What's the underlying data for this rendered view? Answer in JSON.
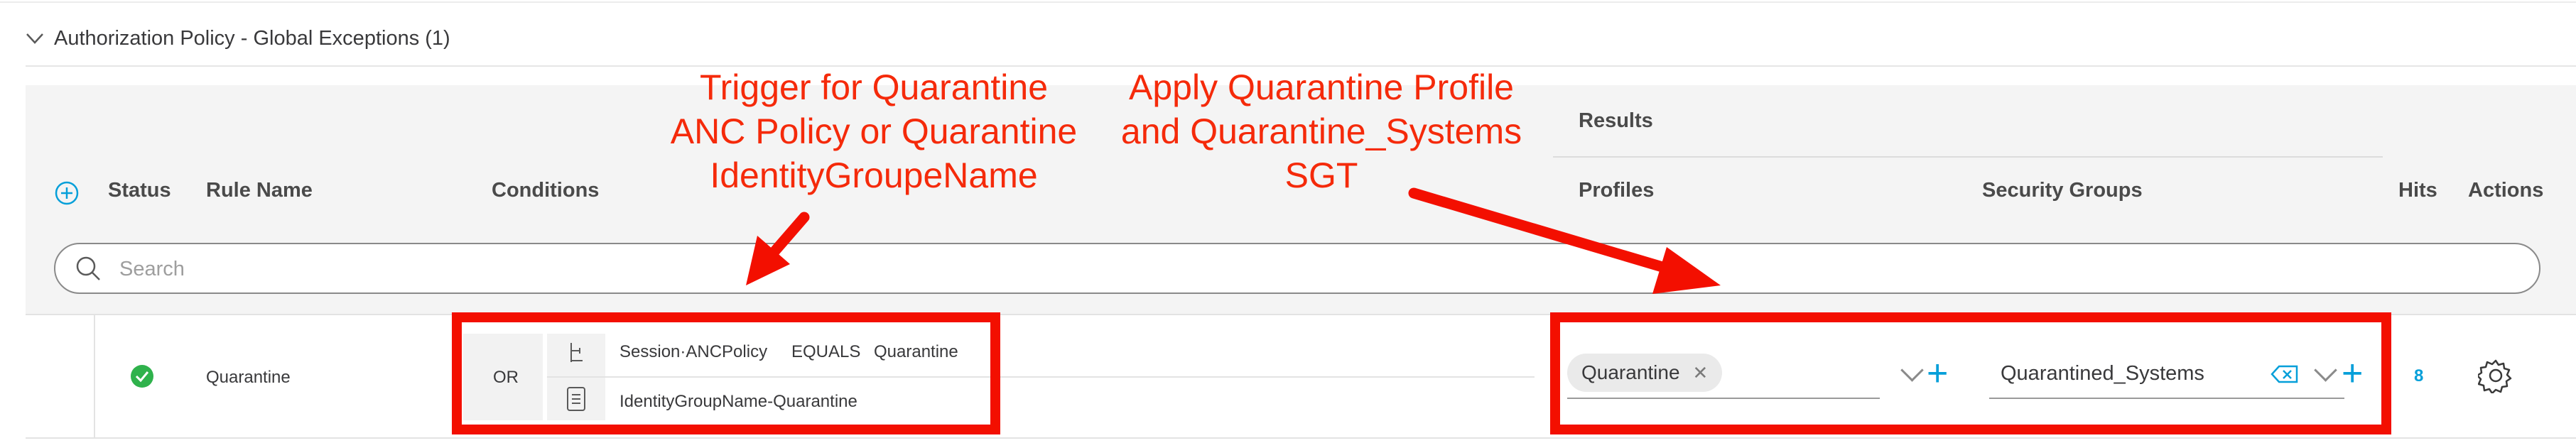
{
  "section": {
    "title": "Authorization Policy - Global Exceptions (1)"
  },
  "table": {
    "headers": {
      "status": "Status",
      "rule_name": "Rule Name",
      "conditions": "Conditions",
      "results": "Results",
      "profiles": "Profiles",
      "security_groups": "Security Groups",
      "hits": "Hits",
      "actions": "Actions"
    },
    "search_placeholder": "Search"
  },
  "rule": {
    "status": "enabled",
    "name": "Quarantine",
    "operator": "OR",
    "conditions": [
      {
        "attribute": "Session·ANCPolicy",
        "operator": "EQUALS",
        "value": "Quarantine",
        "icon": "condition-tree-icon"
      },
      {
        "attribute": "IdentityGroupName-Quarantine",
        "icon": "library-condition-icon"
      }
    ],
    "profile": "Quarantine",
    "security_group": "Quarantined_Systems",
    "hits": "8"
  },
  "annotations": {
    "conditions_note": [
      "Trigger for Quarantine",
      "ANC Policy or Quarantine",
      "IdentityGroupeName"
    ],
    "results_note": [
      "Apply Quarantine Profile",
      "and Quarantine_Systems",
      "SGT"
    ]
  },
  "colors": {
    "accent": "#049fd9",
    "status_ok": "#2fb24c",
    "annotation_red": "#f30f00",
    "header_bg": "#f4f4f4"
  }
}
